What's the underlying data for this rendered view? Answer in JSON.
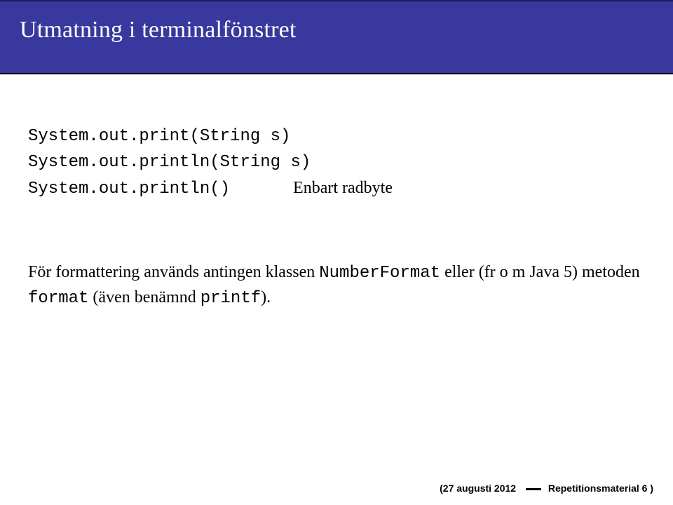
{
  "header": {
    "title": "Utmatning i terminalfönstret"
  },
  "code": {
    "l1": "System.out.print(String s)",
    "l2": "System.out.println(String s)",
    "l3": "System.out.println()",
    "l3_note": "Enbart radbyte"
  },
  "para": {
    "t1": "För formattering används antingen klassen ",
    "c1": "NumberFormat",
    "t2": " eller (fr o m Java 5) metoden ",
    "c2": "format",
    "t3": " (även benämnd ",
    "c3": "printf",
    "t4": ")."
  },
  "footer": {
    "date_label": "(27 augusti 2012",
    "page_label": "Repetitionsmaterial 6 )"
  }
}
